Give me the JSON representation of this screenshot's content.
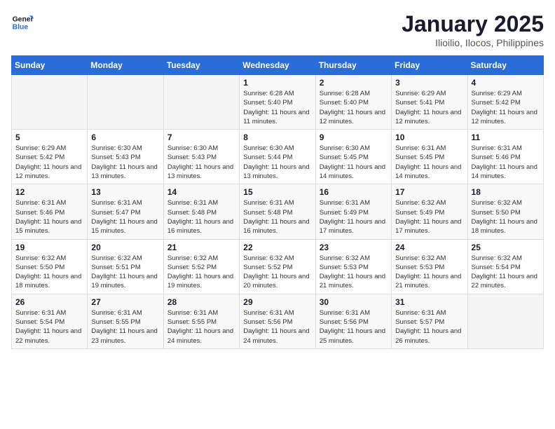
{
  "logo": {
    "text_general": "General",
    "text_blue": "Blue"
  },
  "header": {
    "title": "January 2025",
    "subtitle": "Ilioilio, Ilocos, Philippines"
  },
  "weekdays": [
    "Sunday",
    "Monday",
    "Tuesday",
    "Wednesday",
    "Thursday",
    "Friday",
    "Saturday"
  ],
  "weeks": [
    [
      {
        "day": "",
        "empty": true
      },
      {
        "day": "",
        "empty": true
      },
      {
        "day": "",
        "empty": true
      },
      {
        "day": "1",
        "sunrise": "Sunrise: 6:28 AM",
        "sunset": "Sunset: 5:40 PM",
        "daylight": "Daylight: 11 hours and 11 minutes."
      },
      {
        "day": "2",
        "sunrise": "Sunrise: 6:28 AM",
        "sunset": "Sunset: 5:40 PM",
        "daylight": "Daylight: 11 hours and 12 minutes."
      },
      {
        "day": "3",
        "sunrise": "Sunrise: 6:29 AM",
        "sunset": "Sunset: 5:41 PM",
        "daylight": "Daylight: 11 hours and 12 minutes."
      },
      {
        "day": "4",
        "sunrise": "Sunrise: 6:29 AM",
        "sunset": "Sunset: 5:42 PM",
        "daylight": "Daylight: 11 hours and 12 minutes."
      }
    ],
    [
      {
        "day": "5",
        "sunrise": "Sunrise: 6:29 AM",
        "sunset": "Sunset: 5:42 PM",
        "daylight": "Daylight: 11 hours and 12 minutes."
      },
      {
        "day": "6",
        "sunrise": "Sunrise: 6:30 AM",
        "sunset": "Sunset: 5:43 PM",
        "daylight": "Daylight: 11 hours and 13 minutes."
      },
      {
        "day": "7",
        "sunrise": "Sunrise: 6:30 AM",
        "sunset": "Sunset: 5:43 PM",
        "daylight": "Daylight: 11 hours and 13 minutes."
      },
      {
        "day": "8",
        "sunrise": "Sunrise: 6:30 AM",
        "sunset": "Sunset: 5:44 PM",
        "daylight": "Daylight: 11 hours and 13 minutes."
      },
      {
        "day": "9",
        "sunrise": "Sunrise: 6:30 AM",
        "sunset": "Sunset: 5:45 PM",
        "daylight": "Daylight: 11 hours and 14 minutes."
      },
      {
        "day": "10",
        "sunrise": "Sunrise: 6:31 AM",
        "sunset": "Sunset: 5:45 PM",
        "daylight": "Daylight: 11 hours and 14 minutes."
      },
      {
        "day": "11",
        "sunrise": "Sunrise: 6:31 AM",
        "sunset": "Sunset: 5:46 PM",
        "daylight": "Daylight: 11 hours and 14 minutes."
      }
    ],
    [
      {
        "day": "12",
        "sunrise": "Sunrise: 6:31 AM",
        "sunset": "Sunset: 5:46 PM",
        "daylight": "Daylight: 11 hours and 15 minutes."
      },
      {
        "day": "13",
        "sunrise": "Sunrise: 6:31 AM",
        "sunset": "Sunset: 5:47 PM",
        "daylight": "Daylight: 11 hours and 15 minutes."
      },
      {
        "day": "14",
        "sunrise": "Sunrise: 6:31 AM",
        "sunset": "Sunset: 5:48 PM",
        "daylight": "Daylight: 11 hours and 16 minutes."
      },
      {
        "day": "15",
        "sunrise": "Sunrise: 6:31 AM",
        "sunset": "Sunset: 5:48 PM",
        "daylight": "Daylight: 11 hours and 16 minutes."
      },
      {
        "day": "16",
        "sunrise": "Sunrise: 6:31 AM",
        "sunset": "Sunset: 5:49 PM",
        "daylight": "Daylight: 11 hours and 17 minutes."
      },
      {
        "day": "17",
        "sunrise": "Sunrise: 6:32 AM",
        "sunset": "Sunset: 5:49 PM",
        "daylight": "Daylight: 11 hours and 17 minutes."
      },
      {
        "day": "18",
        "sunrise": "Sunrise: 6:32 AM",
        "sunset": "Sunset: 5:50 PM",
        "daylight": "Daylight: 11 hours and 18 minutes."
      }
    ],
    [
      {
        "day": "19",
        "sunrise": "Sunrise: 6:32 AM",
        "sunset": "Sunset: 5:50 PM",
        "daylight": "Daylight: 11 hours and 18 minutes."
      },
      {
        "day": "20",
        "sunrise": "Sunrise: 6:32 AM",
        "sunset": "Sunset: 5:51 PM",
        "daylight": "Daylight: 11 hours and 19 minutes."
      },
      {
        "day": "21",
        "sunrise": "Sunrise: 6:32 AM",
        "sunset": "Sunset: 5:52 PM",
        "daylight": "Daylight: 11 hours and 19 minutes."
      },
      {
        "day": "22",
        "sunrise": "Sunrise: 6:32 AM",
        "sunset": "Sunset: 5:52 PM",
        "daylight": "Daylight: 11 hours and 20 minutes."
      },
      {
        "day": "23",
        "sunrise": "Sunrise: 6:32 AM",
        "sunset": "Sunset: 5:53 PM",
        "daylight": "Daylight: 11 hours and 21 minutes."
      },
      {
        "day": "24",
        "sunrise": "Sunrise: 6:32 AM",
        "sunset": "Sunset: 5:53 PM",
        "daylight": "Daylight: 11 hours and 21 minutes."
      },
      {
        "day": "25",
        "sunrise": "Sunrise: 6:32 AM",
        "sunset": "Sunset: 5:54 PM",
        "daylight": "Daylight: 11 hours and 22 minutes."
      }
    ],
    [
      {
        "day": "26",
        "sunrise": "Sunrise: 6:31 AM",
        "sunset": "Sunset: 5:54 PM",
        "daylight": "Daylight: 11 hours and 22 minutes."
      },
      {
        "day": "27",
        "sunrise": "Sunrise: 6:31 AM",
        "sunset": "Sunset: 5:55 PM",
        "daylight": "Daylight: 11 hours and 23 minutes."
      },
      {
        "day": "28",
        "sunrise": "Sunrise: 6:31 AM",
        "sunset": "Sunset: 5:55 PM",
        "daylight": "Daylight: 11 hours and 24 minutes."
      },
      {
        "day": "29",
        "sunrise": "Sunrise: 6:31 AM",
        "sunset": "Sunset: 5:56 PM",
        "daylight": "Daylight: 11 hours and 24 minutes."
      },
      {
        "day": "30",
        "sunrise": "Sunrise: 6:31 AM",
        "sunset": "Sunset: 5:56 PM",
        "daylight": "Daylight: 11 hours and 25 minutes."
      },
      {
        "day": "31",
        "sunrise": "Sunrise: 6:31 AM",
        "sunset": "Sunset: 5:57 PM",
        "daylight": "Daylight: 11 hours and 26 minutes."
      },
      {
        "day": "",
        "empty": true
      }
    ]
  ]
}
